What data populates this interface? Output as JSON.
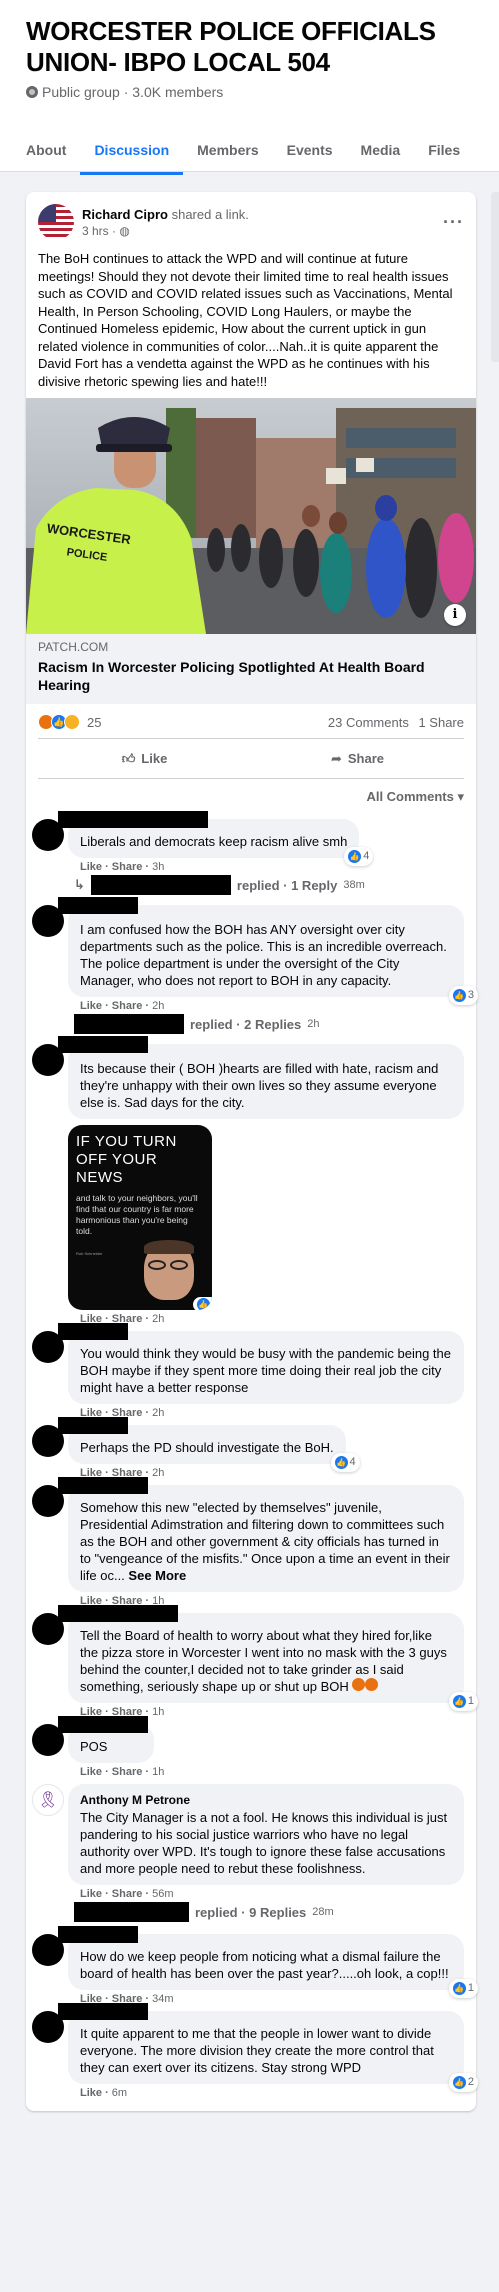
{
  "group": {
    "title": "WORCESTER POLICE OFFICIALS UNION- IBPO LOCAL 504",
    "meta": "Public group · 3.0K members",
    "tabs": [
      "About",
      "Discussion",
      "Members",
      "Events",
      "Media",
      "Files"
    ],
    "active_tab": "Discussion"
  },
  "post": {
    "author": "Richard Cipro",
    "shared_text": "shared a link.",
    "time": "3 hrs · ",
    "more_icon": "more-dots-icon",
    "text": "The BoH continues to attack the WPD and will continue at future meetings! Should they not devote their limited time to real health issues such as COVID and COVID related issues such as Vaccinations, Mental Health, In Person Schooling, COVID Long Haulers, or maybe the Continued Homeless epidemic, How about the current uptick in gun related violence in communities of color....Nah..it is quite apparent the David Fort has a vendetta against the WPD as he continues with his divisive rhetoric spewing lies and hate!!!",
    "link": {
      "domain": "PATCH.COM",
      "title": "Racism In Worcester Policing Spotlighted At Health Board Hearing",
      "vest_text_1": "WORCESTER",
      "vest_text_2": "POLICE",
      "info_label": "i"
    },
    "reaction_count": "25",
    "comments_count": "23 Comments",
    "shares_count": "1 Share",
    "like_label": "Like",
    "share_label": "Share",
    "filter_label": "All Comments"
  },
  "comments": [
    {
      "text": "Liberals and democrats keep racism alive smh",
      "actions": "Like · Share · ",
      "time": "3h",
      "count": "4",
      "reply": {
        "label": "replied · 1 Reply",
        "time": "38m"
      }
    },
    {
      "text": "I am confused how the BOH has ANY oversight over city departments such as the police. This is an incredible overreach. The police department is under the oversight of the City Manager, who does not report to BOH in any capacity.",
      "actions": "Like · Share · ",
      "time": "2h",
      "count": "3",
      "reply": {
        "label": "replied · 2 Replies",
        "time": "2h"
      }
    },
    {
      "text": "Its because their ( BOH )hearts are filled with hate, racism and they're unhappy with their own lives so they assume everyone else is. Sad days for the city.",
      "actions": "Like · Share · ",
      "time": "2h",
      "count": "4",
      "meme": {
        "headline": "IF YOU TURN OFF YOUR NEWS",
        "sub": "and talk to your neighbors, you'll find that our country is far more harmonious than you're being told.",
        "attribution": "Rob Schneider"
      }
    },
    {
      "text": "You would think they would be busy with the pandemic being the BOH maybe if they spent more time doing their real job the city might have a better response",
      "actions": "Like · Share · ",
      "time": "2h"
    },
    {
      "text": "Perhaps the PD should investigate the BoH.",
      "actions": "Like · Share · ",
      "time": "2h",
      "count": "4"
    },
    {
      "text": "Somehow this new \"elected by themselves\" juvenile, Presidential Adimstration and filtering down to committees such as the BOH and other government & city officials has turned in to \"vengeance of the misfits.\" Once upon a time an event in their life oc...",
      "see_more": "See More",
      "actions": "Like · Share · ",
      "time": "1h"
    },
    {
      "text": "Tell the Board of health to worry about what they hired for,like the pizza store in Worcester I went into no mask with the 3 guys behind the counter,I decided not to take grinder as I said something, seriously shape up or shut up BOH",
      "actions": "Like · Share · ",
      "time": "1h",
      "count": "1"
    },
    {
      "text": "POS",
      "actions": "Like · Share · ",
      "time": "1h"
    },
    {
      "name": "Anthony M Petrone",
      "text": "The City Manager is a not a fool. He knows this individual is just pandering to his social justice warriors who have no legal authority over WPD. It's tough to ignore these false accusations and more people need to rebut these foolishness.",
      "actions": "Like · Share · ",
      "time": "56m",
      "reply": {
        "label": "replied · 9 Replies",
        "time": "28m"
      }
    },
    {
      "text": "How do we keep people from noticing what a dismal failure the board of health has been over the past year?.....oh look, a cop!!!",
      "actions": "Like · Share · ",
      "time": "34m",
      "count": "1"
    },
    {
      "text": "It quite apparent to me that the people in lower want to divide everyone. The more division they create the more control that they can exert over its citizens. Stay strong WPD",
      "actions": "Like · ",
      "time": "6m",
      "count": "2"
    }
  ]
}
